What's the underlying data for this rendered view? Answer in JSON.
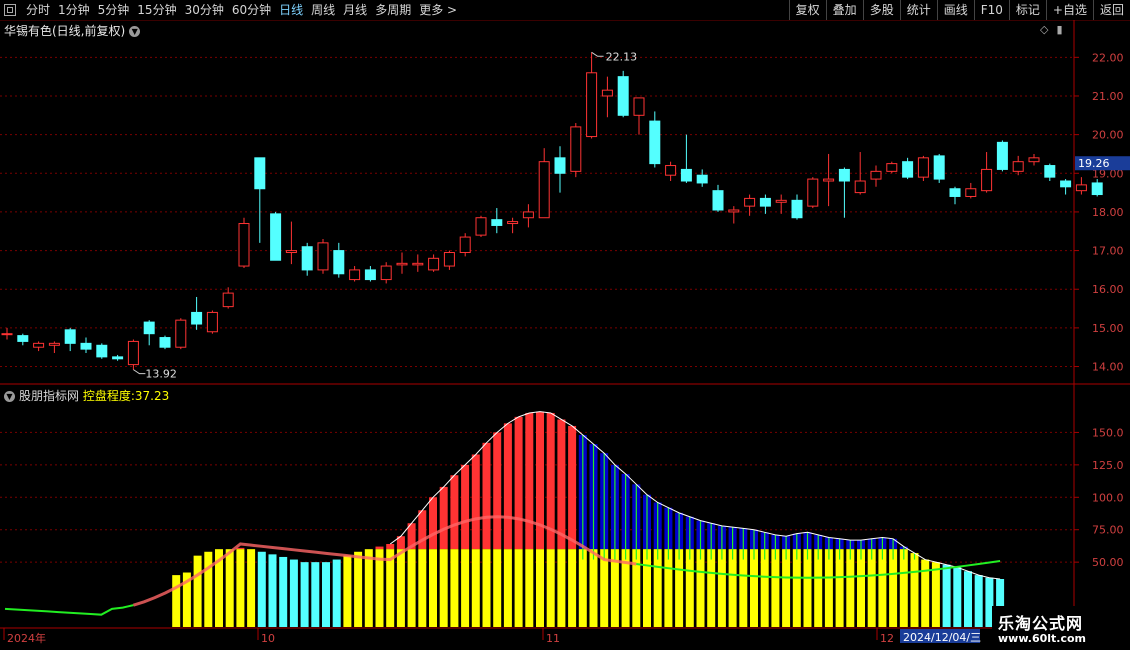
{
  "toolbar": {
    "left": [
      "分时",
      "1分钟",
      "5分钟",
      "15分钟",
      "30分钟",
      "60分钟",
      "日线",
      "周线",
      "月线",
      "多周期",
      "更多 >"
    ],
    "active_index": 6,
    "right": [
      "复权",
      "叠加",
      "多股",
      "统计",
      "画线",
      "F10",
      "标记",
      "+自选",
      "返回"
    ]
  },
  "stock": {
    "title": "华锡有色(日线,前复权)",
    "dropdown_icon": "chevron-down-icon"
  },
  "price_axis": {
    "labels": [
      "22.00",
      "21.00",
      "20.00",
      "19.00",
      "18.00",
      "17.00",
      "16.00",
      "15.00",
      "14.00"
    ],
    "current": "19.26"
  },
  "annotations": {
    "high": "22.13",
    "low": "13.92"
  },
  "indicator": {
    "name": "股朋指标网",
    "label": "控盘程度:",
    "value": "37.23",
    "axis_labels": [
      "150.0",
      "125.0",
      "100.0",
      "75.00",
      "50.00"
    ]
  },
  "date_axis": {
    "labels": [
      "2024年",
      "10",
      "11",
      "12"
    ],
    "cursor_date": "2024/12/04/三"
  },
  "watermark": {
    "line1": "乐淘公式网",
    "line2": "www.60lt.com"
  },
  "colors": {
    "up": "#ff3333",
    "down": "#54ffff",
    "yellow": "#ffff00",
    "blue": "#0000cc",
    "green": "#22ee22",
    "grid": "#7a0000"
  },
  "chart_data": [
    {
      "type": "candlestick",
      "title": "华锡有色(日线,前复权)",
      "ylim": [
        13.6,
        22.5
      ],
      "candles": [
        [
          14.83,
          14.85,
          14.7,
          15.0
        ],
        [
          14.8,
          14.65,
          14.55,
          14.85
        ],
        [
          14.5,
          14.6,
          14.4,
          14.65
        ],
        [
          14.55,
          14.6,
          14.35,
          14.65
        ],
        [
          14.95,
          14.6,
          14.4,
          15.0
        ],
        [
          14.6,
          14.45,
          14.35,
          14.75
        ],
        [
          14.55,
          14.25,
          14.2,
          14.6
        ],
        [
          14.25,
          14.2,
          14.15,
          14.3
        ],
        [
          14.05,
          14.65,
          13.92,
          14.7
        ],
        [
          15.15,
          14.85,
          14.55,
          15.2
        ],
        [
          14.75,
          14.5,
          14.45,
          14.8
        ],
        [
          14.5,
          15.2,
          14.45,
          15.25
        ],
        [
          15.4,
          15.1,
          14.95,
          15.8
        ],
        [
          14.9,
          15.4,
          14.85,
          15.45
        ],
        [
          15.55,
          15.9,
          15.5,
          16.05
        ],
        [
          16.6,
          17.7,
          16.55,
          17.85
        ],
        [
          19.4,
          18.6,
          17.2,
          19.4
        ],
        [
          17.95,
          16.75,
          16.75,
          18.0
        ],
        [
          16.95,
          17.0,
          16.65,
          17.75
        ],
        [
          17.1,
          16.5,
          16.35,
          17.2
        ],
        [
          16.5,
          17.2,
          16.4,
          17.3
        ],
        [
          17.0,
          16.4,
          16.3,
          17.2
        ],
        [
          16.25,
          16.5,
          16.2,
          16.6
        ],
        [
          16.5,
          16.25,
          16.2,
          16.6
        ],
        [
          16.25,
          16.6,
          16.15,
          16.7
        ],
        [
          16.63,
          16.67,
          16.4,
          16.95
        ],
        [
          16.63,
          16.67,
          16.45,
          16.9
        ],
        [
          16.5,
          16.8,
          16.45,
          16.9
        ],
        [
          16.6,
          16.95,
          16.5,
          17.0
        ],
        [
          16.95,
          17.35,
          16.85,
          17.45
        ],
        [
          17.4,
          17.85,
          17.35,
          17.9
        ],
        [
          17.8,
          17.65,
          17.45,
          18.1
        ],
        [
          17.7,
          17.75,
          17.45,
          17.85
        ],
        [
          17.85,
          18.0,
          17.6,
          18.2
        ],
        [
          17.85,
          19.3,
          17.85,
          19.65
        ],
        [
          19.4,
          19.0,
          18.5,
          19.7
        ],
        [
          19.05,
          20.2,
          18.9,
          20.3
        ],
        [
          19.95,
          21.6,
          19.9,
          22.13
        ],
        [
          21.0,
          21.15,
          20.45,
          21.5
        ],
        [
          21.5,
          20.5,
          20.45,
          21.65
        ],
        [
          20.5,
          20.95,
          20.0,
          20.95
        ],
        [
          20.35,
          19.25,
          19.15,
          20.6
        ],
        [
          18.95,
          19.2,
          18.8,
          19.3
        ],
        [
          19.1,
          18.8,
          18.75,
          20.0
        ],
        [
          18.95,
          18.75,
          18.65,
          19.1
        ],
        [
          18.55,
          18.05,
          18.0,
          18.7
        ],
        [
          18.0,
          18.05,
          17.7,
          18.15
        ],
        [
          18.15,
          18.35,
          17.9,
          18.45
        ],
        [
          18.35,
          18.15,
          17.95,
          18.45
        ],
        [
          18.25,
          18.3,
          17.95,
          18.45
        ],
        [
          18.3,
          17.85,
          17.8,
          18.45
        ],
        [
          18.15,
          18.85,
          18.1,
          18.9
        ],
        [
          18.8,
          18.85,
          18.15,
          19.5
        ],
        [
          19.1,
          18.8,
          17.85,
          19.15
        ],
        [
          18.5,
          18.8,
          18.45,
          19.55
        ],
        [
          18.85,
          19.05,
          18.65,
          19.2
        ],
        [
          19.05,
          19.25,
          19.0,
          19.3
        ],
        [
          19.3,
          18.9,
          18.85,
          19.4
        ],
        [
          18.9,
          19.4,
          18.8,
          19.45
        ],
        [
          19.45,
          18.85,
          18.75,
          19.5
        ],
        [
          18.6,
          18.4,
          18.2,
          18.65
        ],
        [
          18.4,
          18.6,
          18.35,
          18.75
        ],
        [
          18.55,
          19.1,
          18.5,
          19.55
        ],
        [
          19.8,
          19.1,
          19.05,
          19.85
        ],
        [
          19.05,
          19.3,
          18.95,
          19.45
        ],
        [
          19.3,
          19.4,
          19.2,
          19.5
        ],
        [
          19.2,
          18.9,
          18.8,
          19.25
        ],
        [
          18.8,
          18.65,
          18.45,
          18.85
        ],
        [
          18.55,
          18.7,
          18.45,
          18.9
        ],
        [
          18.75,
          18.45,
          18.4,
          18.85
        ]
      ]
    },
    {
      "type": "bar",
      "title": "控盘程度",
      "ylim": [
        0,
        175
      ],
      "series": [
        {
          "name": "控盘程度",
          "values": [
            0,
            0,
            0,
            0,
            0,
            0,
            0,
            0,
            0,
            0,
            0,
            0,
            0,
            0,
            0,
            0,
            40,
            42,
            55,
            58,
            60,
            60,
            61,
            60,
            58,
            56,
            54,
            52,
            50,
            50,
            50,
            52,
            55,
            58,
            60,
            62,
            64,
            70,
            80,
            90,
            100,
            108,
            117,
            125,
            133,
            142,
            150,
            157,
            162,
            165,
            166,
            165,
            160,
            155,
            148,
            141,
            134,
            125,
            118,
            110,
            102,
            96,
            92,
            88,
            85,
            82,
            80,
            78,
            77,
            76,
            75,
            73,
            71,
            70,
            72,
            73,
            71,
            69,
            68,
            67,
            67,
            68,
            69,
            68,
            62,
            57,
            52,
            50,
            48,
            46,
            43,
            40,
            38,
            37
          ]
        }
      ]
    }
  ]
}
